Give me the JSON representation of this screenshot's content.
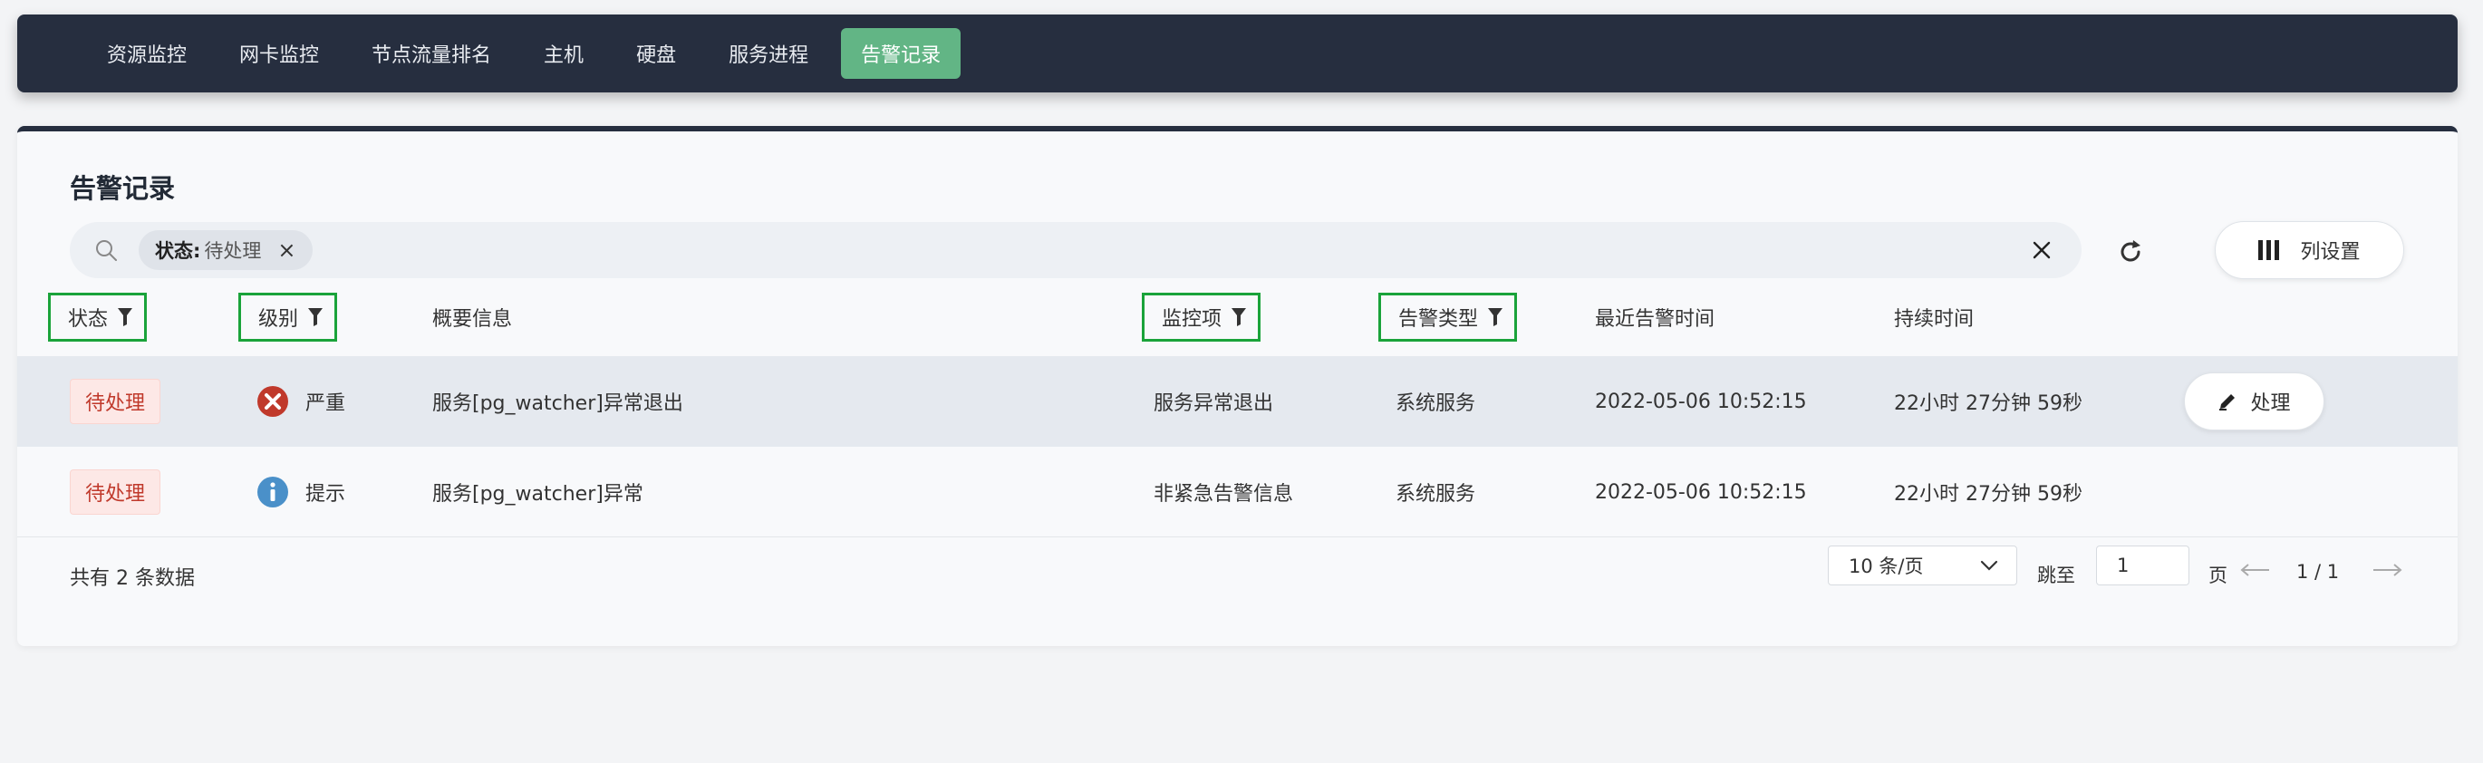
{
  "nav": {
    "items": [
      {
        "label": "资源监控",
        "active": false
      },
      {
        "label": "网卡监控",
        "active": false
      },
      {
        "label": "节点流量排名",
        "active": false
      },
      {
        "label": "主机",
        "active": false
      },
      {
        "label": "硬盘",
        "active": false
      },
      {
        "label": "服务进程",
        "active": false
      },
      {
        "label": "告警记录",
        "active": true
      }
    ],
    "active_color": "#62b585",
    "bar_color": "#262e3f"
  },
  "page": {
    "title": "告警记录"
  },
  "search": {
    "icon": "search-icon",
    "chip": {
      "key": "状态:",
      "value": "待处理"
    },
    "clear_icon": "close-icon"
  },
  "toolbar": {
    "refresh_icon": "refresh-icon",
    "column_settings_label": "列设置",
    "column_settings_icon": "columns-icon"
  },
  "table": {
    "headers": [
      {
        "label": "状态",
        "filter": true
      },
      {
        "label": "级别",
        "filter": true
      },
      {
        "label": "概要信息",
        "filter": false
      },
      {
        "label": "监控项",
        "filter": true
      },
      {
        "label": "告警类型",
        "filter": true
      },
      {
        "label": "最近告警时间",
        "filter": false
      },
      {
        "label": "持续时间",
        "filter": false
      }
    ],
    "rows": [
      {
        "status": "待处理",
        "level": "严重",
        "level_icon": "error-icon",
        "summary": "服务[pg_watcher]异常退出",
        "monitor_item": "服务异常退出",
        "alert_type": "系统服务",
        "last_time": "2022-05-06 10:52:15",
        "duration": "22小时 27分钟 59秒",
        "action_label": "处理"
      },
      {
        "status": "待处理",
        "level": "提示",
        "level_icon": "info-icon",
        "summary": "服务[pg_watcher]异常",
        "monitor_item": "非紧急告警信息",
        "alert_type": "系统服务",
        "last_time": "2022-05-06 10:52:15",
        "duration": "22小时 27分钟 59秒"
      }
    ]
  },
  "pagination": {
    "total_text": "共有 2 条数据",
    "page_size": "10 条/页",
    "jump_label": "跳至",
    "jump_value": "1",
    "page_label": "页",
    "page_info": "1 / 1"
  },
  "colors": {
    "status_tag_text": "#c0392b",
    "status_tag_bg": "#fde8e6",
    "error": "#c0392b",
    "info": "#4a90c9",
    "filter_highlight": "#1aa33a"
  }
}
